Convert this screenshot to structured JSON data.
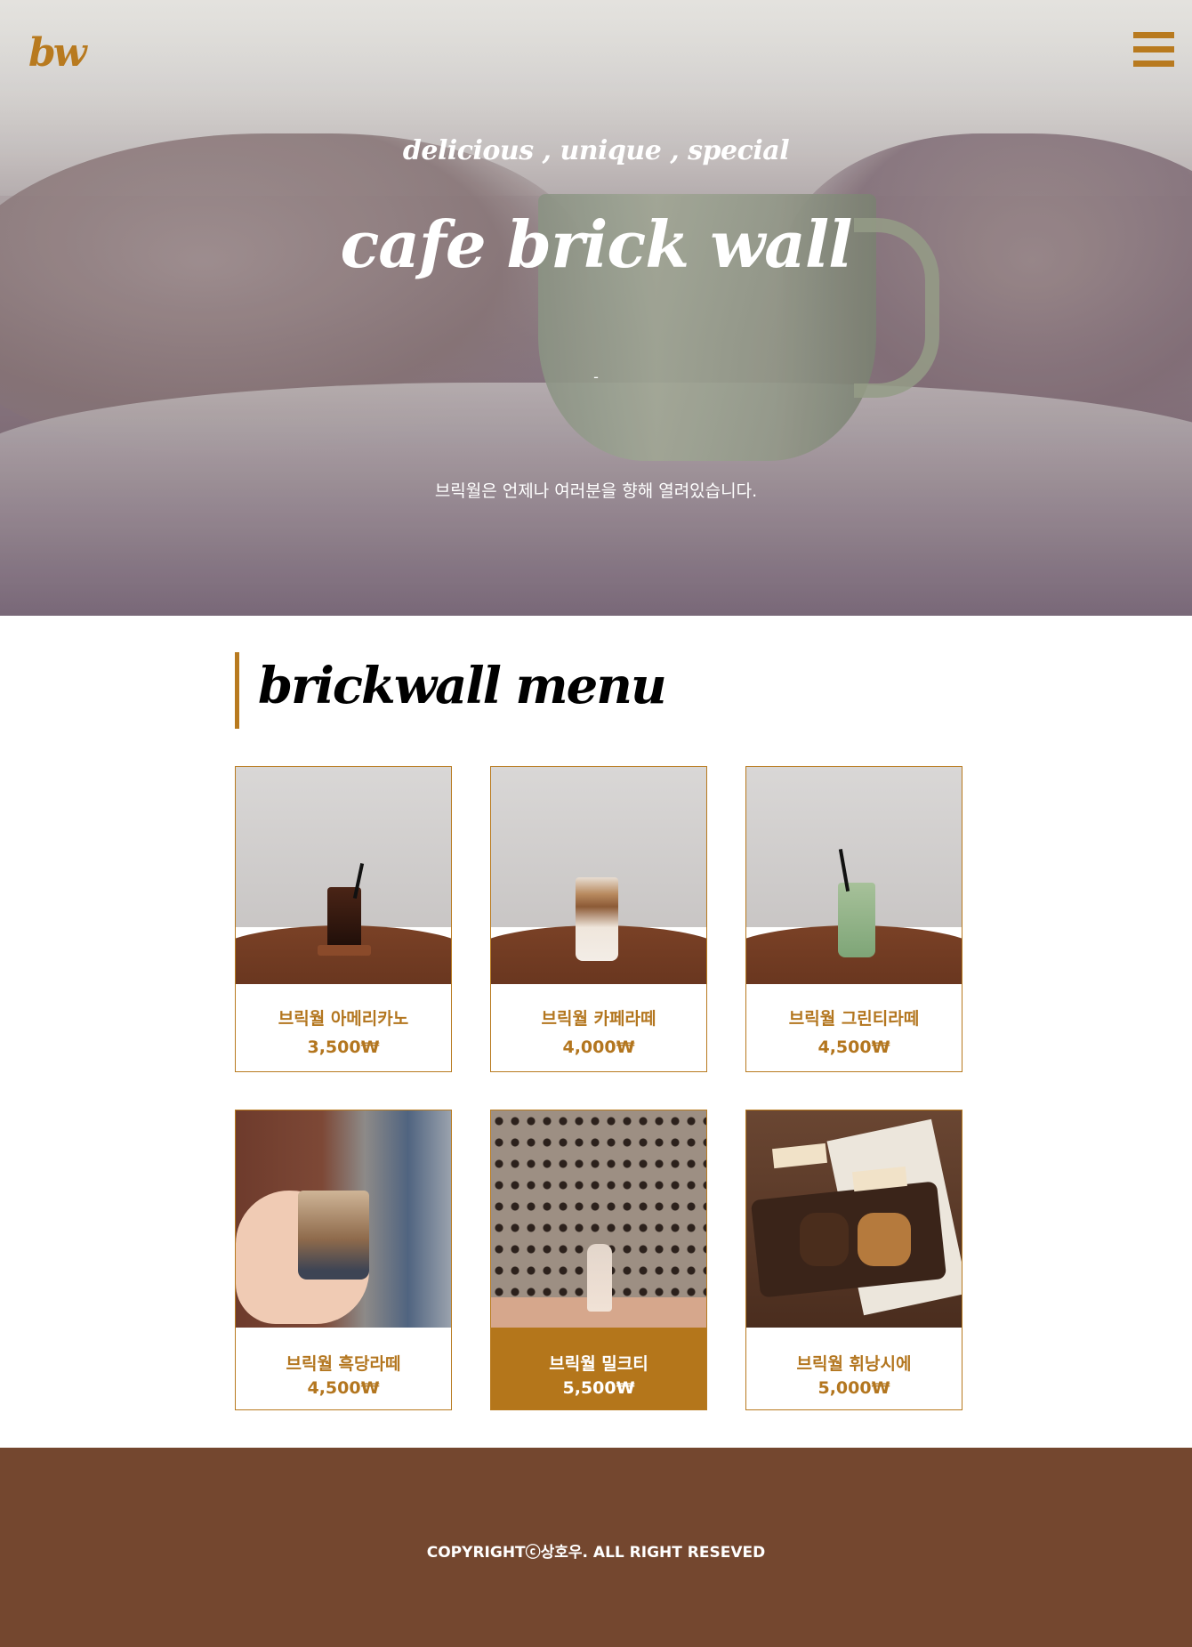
{
  "header": {
    "logo": "bw",
    "menu_icon": "hamburger-icon"
  },
  "hero": {
    "tagline": "delicious , unique , special",
    "title": "cafe brick wall",
    "dash": "-",
    "subtitle": "브릭월은 언제나 여러분을 향해 열려있습니다."
  },
  "menu": {
    "title": "brickwall menu",
    "items": [
      {
        "name": "브릭월 아메리카노",
        "price": "3,500₩"
      },
      {
        "name": "브릭월 카페라떼",
        "price": "4,000₩"
      },
      {
        "name": "브릭월 그린티라떼",
        "price": "4,500₩"
      },
      {
        "name": "브릭월 흑당라떼",
        "price": "4,500₩"
      },
      {
        "name": "브릭월 밀크티",
        "price": "5,500₩"
      },
      {
        "name": "브릭월 휘낭시에",
        "price": "5,000₩"
      }
    ]
  },
  "footer": {
    "copyright": "COPYRIGHTⓒ상호우. ALL RIGHT RESEVED"
  },
  "colors": {
    "accent": "#b87a1f",
    "footer_bg": "#74472f"
  }
}
